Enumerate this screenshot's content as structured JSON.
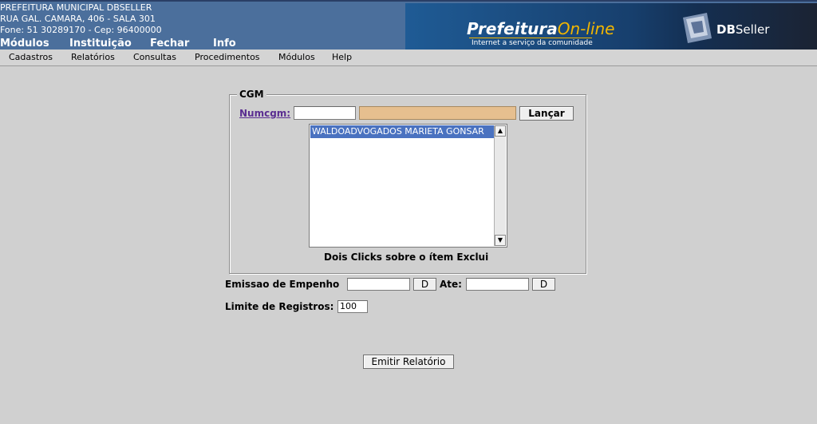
{
  "header": {
    "institution_lines": [
      "PREFEITURA MUNICIPAL DBSELLER",
      "RUA GAL. CAMARA, 406 - SALA 301",
      "Fone: 51 30289170  -  Cep: 96400000"
    ],
    "main_menu": [
      "Módulos",
      "Instituição",
      "Fechar",
      "Info"
    ],
    "banner": {
      "brand_main": "Prefeitura",
      "brand_accent": "On-line",
      "tagline": "Internet a serviço da comunidade",
      "dbseller_bold": "DB",
      "dbseller_rest": "Seller"
    }
  },
  "submenu": [
    "Cadastros",
    "Relatórios",
    "Consultas",
    "Procedimentos",
    "Módulos",
    "Help"
  ],
  "form": {
    "cgm_legend": "CGM",
    "numcgm_label": "Numcgm:",
    "numcgm_value": "",
    "nome_value": "",
    "lancar_label": "Lançar",
    "list_items": [
      "WALDOADVOGADOS MARIETA GONSAR"
    ],
    "hint": "Dois Clicks sobre o ítem Exclui",
    "emissao_label": "Emissao de Empenho",
    "data_ini_value": "",
    "d_button_label": "D",
    "ate_label": "Ate:",
    "data_fim_value": "",
    "limite_label": "Limite de Registros:",
    "limite_value": "100",
    "emitir_label": "Emitir Relatório"
  },
  "colors": {
    "header_bg": "#4b6f9c",
    "page_bg": "#d0d0d0",
    "list_selection": "#4a72c0",
    "readonly_field": "#e6bf8f",
    "link_purple": "#5a2d91",
    "brand_accent": "#f2b600"
  },
  "icons": [
    "dbseller-logo-icon",
    "scroll-up-arrow-icon",
    "scroll-down-arrow-icon"
  ]
}
